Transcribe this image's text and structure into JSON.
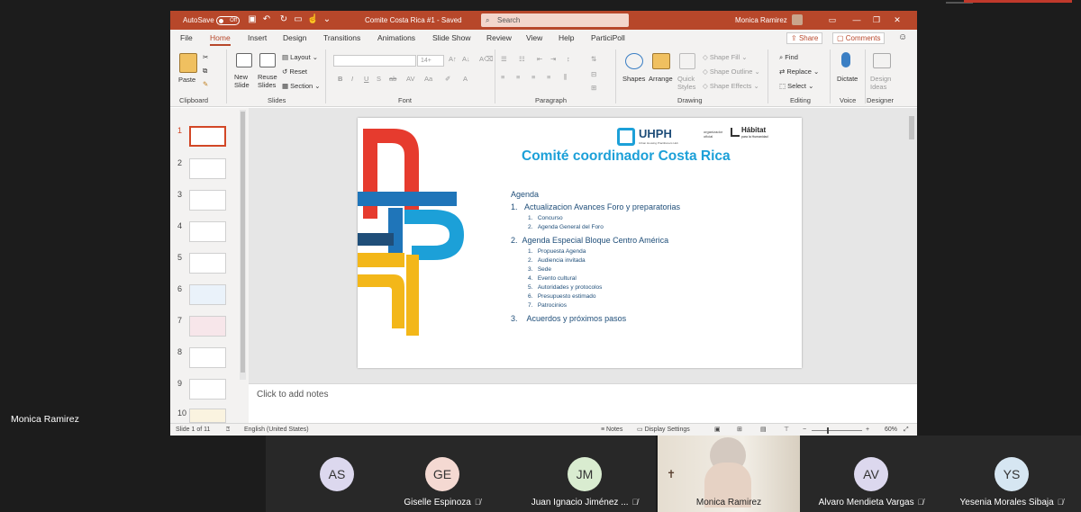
{
  "titlebar": {
    "autosave_label": "AutoSave",
    "autosave_state": "Off",
    "doc_title": "Comite Costa Rica #1  -  Saved",
    "search_placeholder": "Search",
    "user_name": "Monica Ramirez"
  },
  "menu": {
    "items": [
      "File",
      "Home",
      "Insert",
      "Design",
      "Transitions",
      "Animations",
      "Slide Show",
      "Review",
      "View",
      "Help",
      "ParticiPoll"
    ],
    "active": "Home",
    "share_label": "Share",
    "comments_label": "Comments"
  },
  "ribbon": {
    "clipboard": {
      "paste": "Paste",
      "group": "Clipboard"
    },
    "slides": {
      "new_slide": "New\nSlide",
      "reuse_slides": "Reuse\nSlides",
      "layout": "Layout",
      "reset": "Reset",
      "section": "Section",
      "group": "Slides"
    },
    "font": {
      "size": "14+",
      "group": "Font"
    },
    "paragraph": {
      "group": "Paragraph"
    },
    "drawing": {
      "shapes": "Shapes",
      "arrange": "Arrange",
      "quick_styles": "Quick\nStyles",
      "shape_fill": "Shape Fill",
      "shape_outline": "Shape Outline",
      "shape_effects": "Shape Effects",
      "group": "Drawing"
    },
    "editing": {
      "find": "Find",
      "replace": "Replace",
      "select": "Select",
      "group": "Editing"
    },
    "voice": {
      "dictate": "Dictate",
      "group": "Voice"
    },
    "designer": {
      "design_ideas": "Design\nIdeas",
      "group": "Designer"
    }
  },
  "thumbnails": [
    "1",
    "2",
    "3",
    "4",
    "5",
    "6",
    "7",
    "8",
    "9",
    "10"
  ],
  "slide": {
    "logo_text": "UHPH",
    "logo_sub": "Urban Housing Practitioners Hub",
    "organizer_label": "organizador oficial",
    "habitat_label": "Hábitat",
    "habitat_sub": "para la Humanidad",
    "title": "Comité coordinador Costa Rica",
    "agenda_heading": "Agenda",
    "items": [
      {
        "num": "1.",
        "text": "Actualizacion Avances Foro y preparatorias",
        "sub": [
          {
            "num": "1.",
            "text": "Concurso"
          },
          {
            "num": "2.",
            "text": "Agenda General del Foro"
          }
        ]
      },
      {
        "num": "2.",
        "text": "Agenda Especial Bloque Centro América",
        "sub": [
          {
            "num": "1.",
            "text": "Propuesta Agenda"
          },
          {
            "num": "2.",
            "text": "Audiencia invitada"
          },
          {
            "num": "3.",
            "text": "Sede"
          },
          {
            "num": "4.",
            "text": "Evento cultural"
          },
          {
            "num": "5.",
            "text": "Autoridades y protocolos"
          },
          {
            "num": "6.",
            "text": "Presupuesto estimado"
          },
          {
            "num": "7.",
            "text": "Patrocinios"
          }
        ]
      },
      {
        "num": "3.",
        "text": "Acuerdos y próximos pasos",
        "sub": []
      }
    ]
  },
  "notes_placeholder": "Click to add notes",
  "status": {
    "slide_info": "Slide 1 of 11",
    "language": "English (United States)",
    "notes": "Notes",
    "display_settings": "Display Settings",
    "zoom": "60%"
  },
  "meeting": {
    "presenter_name": "Monica Ramirez",
    "participants": [
      {
        "initials": "AS",
        "name": "",
        "color": "#dcd8ee"
      },
      {
        "initials": "GE",
        "name": "Giselle Espinoza",
        "color": "#f4d9d2"
      },
      {
        "initials": "JM",
        "name": "Juan Ignacio Jiménez ...",
        "color": "#d9ecd0"
      },
      {
        "initials": "",
        "name": "Monica Ramirez",
        "color": ""
      },
      {
        "initials": "AV",
        "name": "Alvaro Mendieta Vargas",
        "color": "#dcd8ee"
      },
      {
        "initials": "YS",
        "name": "Yesenia Morales Sibaja",
        "color": "#d6e6f2"
      }
    ]
  },
  "colors": {
    "accent": "#b7472a",
    "slide_title": "#1ca0d8",
    "agenda_text": "#1f4e79"
  }
}
